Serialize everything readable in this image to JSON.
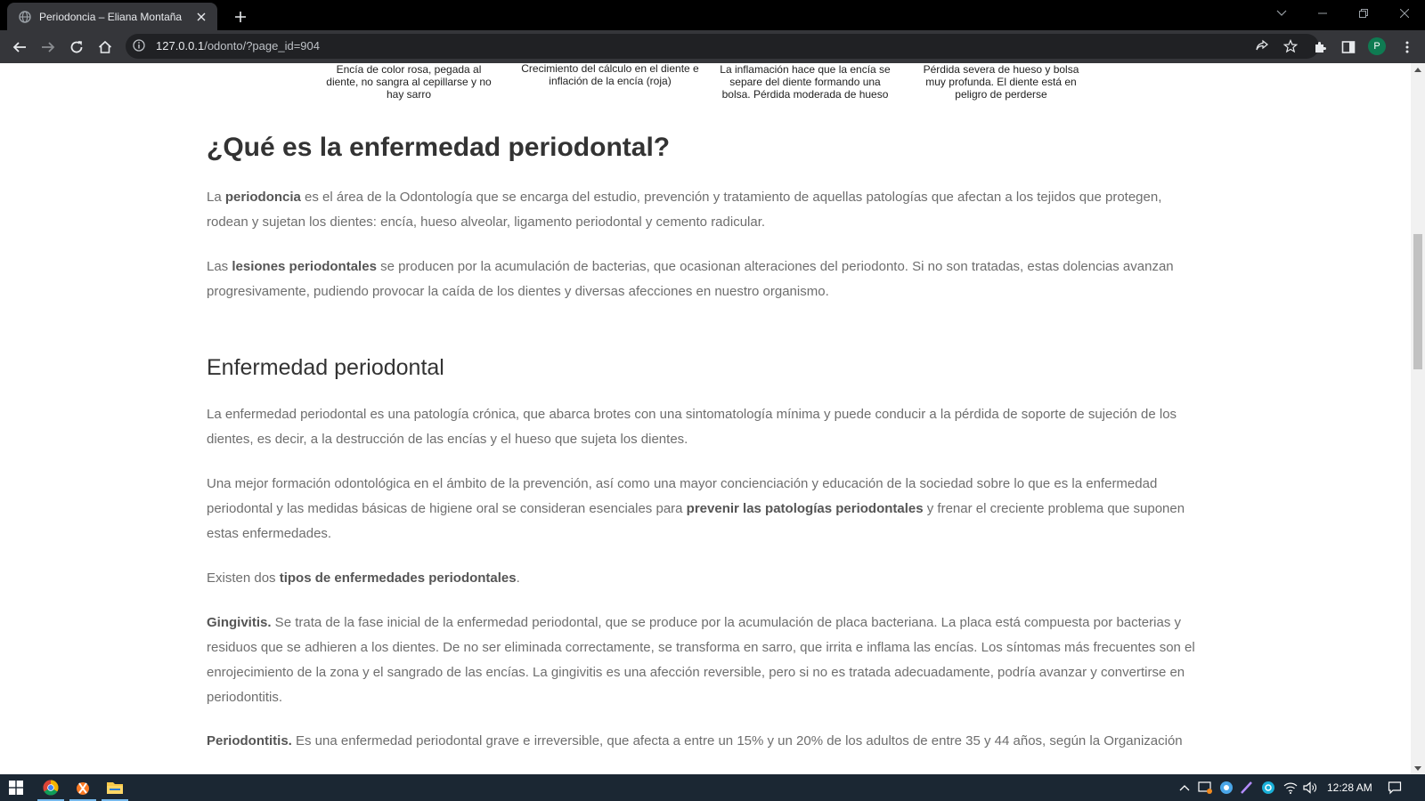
{
  "browser": {
    "tab_title": "Periodoncia – Eliana Montaña",
    "url_host": "127.0.0.1",
    "url_path": "/odonto/?page_id=904",
    "profile_initial": "P"
  },
  "page": {
    "captions": [
      "Encía de color rosa, pegada al diente, no sangra al cepillarse y no hay sarro",
      "Crecimiento del cálculo en el diente e inflación de la encía (roja)",
      "La inflamación hace que la encía se separe del diente formando una bolsa. Pérdida moderada de hueso",
      "Pérdida severa de hueso y bolsa muy profunda. El diente está en peligro de perderse"
    ],
    "heading_what": "¿Qué es la enfermedad periodontal?",
    "p1": {
      "a": "La ",
      "b": "periodoncia",
      "c": " es el área de la Odontología que se encarga del estudio, prevención y tratamiento de aquellas patologías que afectan a los tejidos que protegen, rodean y sujetan los dientes: encía, hueso alveolar, ligamento periodontal y cemento radicular."
    },
    "p2": {
      "a": "Las ",
      "b": "lesiones periodontales",
      "c": " se producen por la acumulación de bacterias, que ocasionan alteraciones del periodonto. Si no son tratadas, estas dolencias avanzan progresivamente, pudiendo provocar la caída de los dientes y diversas afecciones en nuestro organismo."
    },
    "heading_disease": "Enfermedad periodontal",
    "p3": "La enfermedad periodontal es una patología crónica, que abarca brotes con una sintomatología mínima y puede conducir a la pérdida de soporte de sujeción de los dientes, es decir, a la destrucción de las encías y el hueso que sujeta los dientes.",
    "p4": {
      "a": "Una mejor formación odontológica en el ámbito de la prevención, así como una mayor concienciación y educación de la sociedad sobre lo que es la enfermedad periodontal y las medidas básicas de higiene oral se consideran esenciales para ",
      "b": "prevenir las patologías periodontales",
      "c": " y frenar el creciente problema que suponen estas enfermedades."
    },
    "p5": {
      "a": "Existen dos ",
      "b": "tipos de enfermedades periodontales",
      "c": "."
    },
    "p6": {
      "b": "Gingivitis.",
      "c": " Se trata de la fase inicial de la enfermedad periodontal, que se produce por la acumulación de placa bacteriana. La placa está compuesta por bacterias y residuos que se adhieren a los dientes. De no ser eliminada correctamente, se transforma en sarro, que irrita e inflama las encías. Los síntomas más frecuentes son el enrojecimiento de la zona y el sangrado de las encías. La gingivitis es una afección reversible, pero si no es tratada adecuadamente, podría avanzar y convertirse en periodontitis."
    },
    "p7": {
      "b": "Periodontitis.",
      "c": " Es una enfermedad periodontal grave e irreversible, que afecta a entre un 15% y un 20% de los adultos de entre 35 y 44 años, según la Organización"
    }
  },
  "taskbar": {
    "clock": "12:28 AM"
  },
  "icons": {
    "favicon": "globe-icon",
    "tab_close": "close-icon",
    "new_tab": "plus-icon",
    "back": "back-arrow-icon",
    "forward": "forward-arrow-icon",
    "reload": "reload-icon",
    "home": "home-icon",
    "site_info": "info-icon",
    "share": "share-icon",
    "bookmark": "star-icon",
    "extensions": "puzzle-icon",
    "side_panel": "side-panel-icon",
    "menu": "kebab-menu-icon"
  }
}
